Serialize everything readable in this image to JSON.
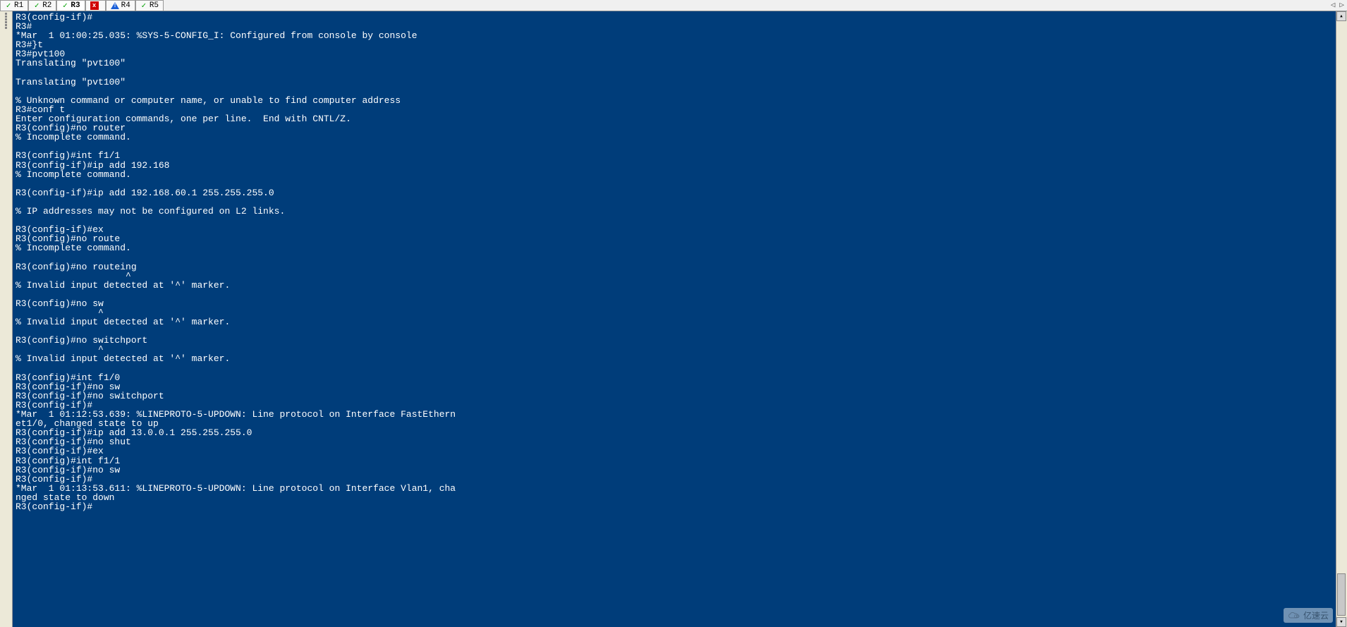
{
  "tabs": [
    {
      "label": "R1",
      "status": "check"
    },
    {
      "label": "R2",
      "status": "check"
    },
    {
      "label": "R3",
      "status": "check",
      "active": true
    },
    {
      "label": "",
      "status": "close"
    },
    {
      "label": "R4",
      "status": "warn"
    },
    {
      "label": "R5",
      "status": "check"
    }
  ],
  "nav": {
    "left": "◁",
    "right": "▷"
  },
  "terminal_lines": [
    "R3(config-if)#",
    "R3#",
    "*Mar  1 01:00:25.035: %SYS-5-CONFIG_I: Configured from console by console",
    "R3#}t",
    "R3#pvt100",
    "Translating \"pvt100\"",
    "",
    "Translating \"pvt100\"",
    "",
    "% Unknown command or computer name, or unable to find computer address",
    "R3#conf t",
    "Enter configuration commands, one per line.  End with CNTL/Z.",
    "R3(config)#no router",
    "% Incomplete command.",
    "",
    "R3(config)#int f1/1",
    "R3(config-if)#ip add 192.168",
    "% Incomplete command.",
    "",
    "R3(config-if)#ip add 192.168.60.1 255.255.255.0",
    "",
    "% IP addresses may not be configured on L2 links.",
    "",
    "R3(config-if)#ex",
    "R3(config)#no route",
    "% Incomplete command.",
    "",
    "R3(config)#no routeing",
    "                    ^",
    "% Invalid input detected at '^' marker.",
    "",
    "R3(config)#no sw",
    "               ^",
    "% Invalid input detected at '^' marker.",
    "",
    "R3(config)#no switchport",
    "               ^",
    "% Invalid input detected at '^' marker.",
    "",
    "R3(config)#int f1/0",
    "R3(config-if)#no sw",
    "R3(config-if)#no switchport",
    "R3(config-if)#",
    "*Mar  1 01:12:53.639: %LINEPROTO-5-UPDOWN: Line protocol on Interface FastEthern",
    "et1/0, changed state to up",
    "R3(config-if)#ip add 13.0.0.1 255.255.255.0",
    "R3(config-if)#no shut",
    "R3(config-if)#ex",
    "R3(config)#int f1/1",
    "R3(config-if)#no sw",
    "R3(config-if)#",
    "*Mar  1 01:13:53.611: %LINEPROTO-5-UPDOWN: Line protocol on Interface Vlan1, cha",
    "nged state to down",
    "R3(config-if)#"
  ],
  "watermark": {
    "text": "亿速云"
  },
  "colors": {
    "terminal_bg": "#003d7a",
    "terminal_fg": "#ffffff",
    "check": "#00a000",
    "close_bg": "#d00000",
    "warn": "#1a5fd8"
  }
}
